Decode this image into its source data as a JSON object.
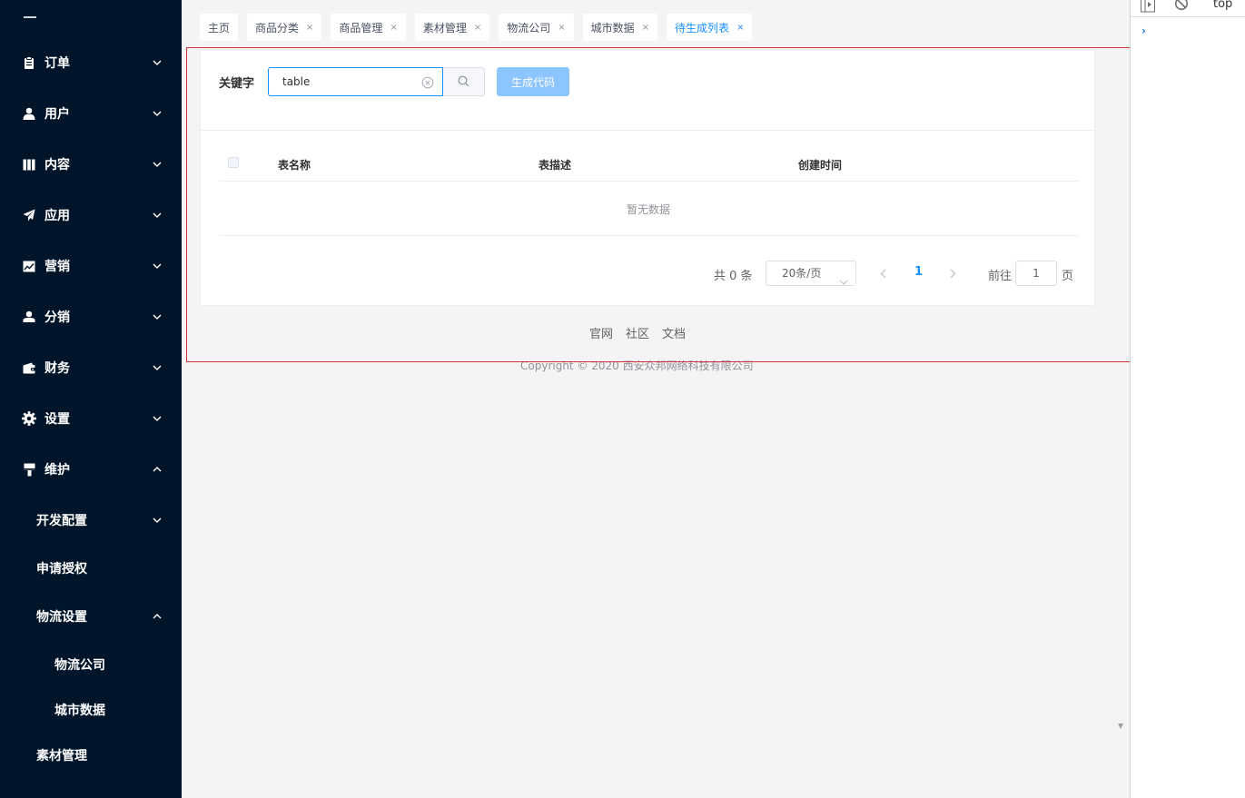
{
  "sidebar": {
    "items": [
      {
        "label": "订单",
        "icon": "clipboard-icon",
        "expanded": false
      },
      {
        "label": "用户",
        "icon": "user-icon",
        "expanded": false
      },
      {
        "label": "内容",
        "icon": "book-icon",
        "expanded": false
      },
      {
        "label": "应用",
        "icon": "send-icon",
        "expanded": false
      },
      {
        "label": "营销",
        "icon": "trend-chart-icon",
        "expanded": false
      },
      {
        "label": "分销",
        "icon": "person-icon",
        "expanded": false
      },
      {
        "label": "财务",
        "icon": "wallet-icon",
        "expanded": false
      },
      {
        "label": "设置",
        "icon": "gear-icon",
        "expanded": false
      },
      {
        "label": "维护",
        "icon": "brush-icon",
        "expanded": true
      }
    ],
    "sub_items": [
      {
        "label": "开发配置",
        "has_children": true,
        "expanded": false
      },
      {
        "label": "申请授权",
        "has_children": false
      },
      {
        "label": "物流设置",
        "has_children": true,
        "expanded": true
      }
    ],
    "subsub_items": [
      {
        "label": "物流公司"
      },
      {
        "label": "城市数据"
      }
    ],
    "bottom_items": [
      {
        "label": "素材管理"
      }
    ]
  },
  "tabs": [
    {
      "label": "主页",
      "closable": false,
      "active": false
    },
    {
      "label": "商品分类",
      "closable": true,
      "active": false
    },
    {
      "label": "商品管理",
      "closable": true,
      "active": false
    },
    {
      "label": "素材管理",
      "closable": true,
      "active": false
    },
    {
      "label": "物流公司",
      "closable": true,
      "active": false
    },
    {
      "label": "城市数据",
      "closable": true,
      "active": false
    },
    {
      "label": "待生成列表",
      "closable": true,
      "active": true
    }
  ],
  "tab_close_glyph": "×",
  "search": {
    "label": "关键字",
    "value": "table",
    "generate_button": "生成代码"
  },
  "table": {
    "columns": [
      "表名称",
      "表描述",
      "创建时间"
    ],
    "empty_text": "暂无数据"
  },
  "pagination": {
    "total": "共 0 条",
    "page_size": "20条/页",
    "current_page": "1",
    "goto_label": "前往",
    "goto_value": "1",
    "page_suffix": "页"
  },
  "footer": {
    "links": [
      "官网",
      "社区",
      "文档"
    ],
    "copyright": "Copyright © 2020 西安众邦网络科技有限公司"
  },
  "devtools": {
    "context": "top",
    "prompt": "›"
  },
  "colors": {
    "sidebar_bg": "#001529",
    "accent": "#1890ff",
    "highlight_box": "#d9303a"
  }
}
